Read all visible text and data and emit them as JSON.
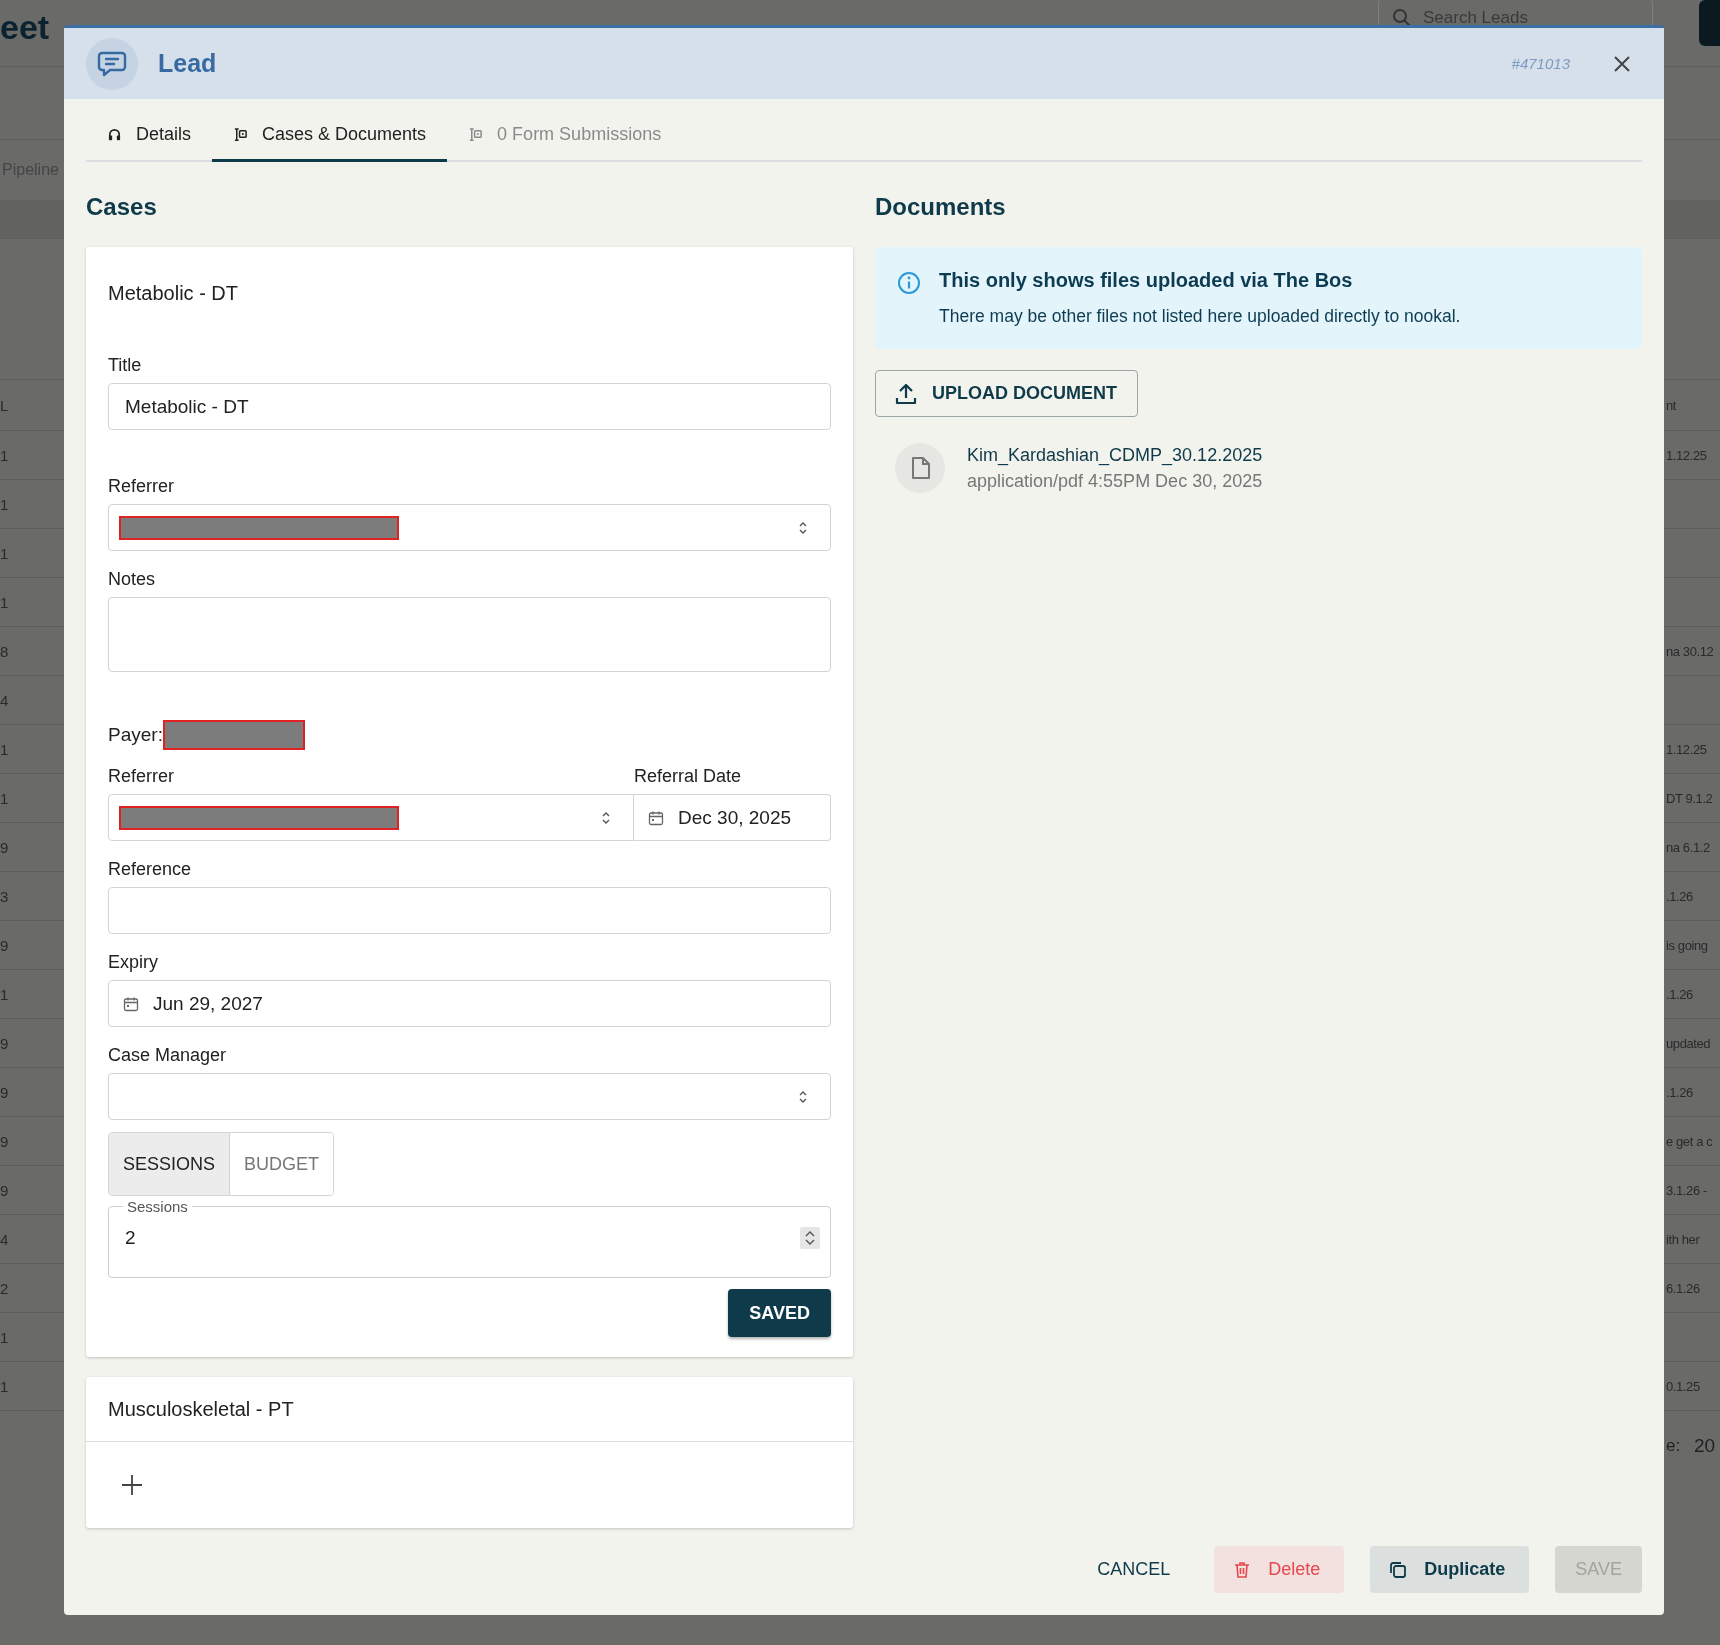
{
  "background": {
    "page_title": "eet",
    "search": {
      "placeholder": "Search Leads"
    },
    "pipeline_label": "Pipeline",
    "table": {
      "columns": [
        "L",
        "nt"
      ],
      "rows": [
        {
          "column_1": "1",
          "column_2": "1.12.25"
        },
        {
          "column_1": "1",
          "column_2": ""
        },
        {
          "column_1": "1",
          "column_2": ""
        },
        {
          "column_1": "1",
          "column_2": ""
        },
        {
          "column_1": "8",
          "column_2": "na 30.12"
        },
        {
          "column_1": "4",
          "column_2": ""
        },
        {
          "column_1": "1",
          "column_2": "1.12.25"
        },
        {
          "column_1": "1",
          "column_2": "DT 9.1.2"
        },
        {
          "column_1": "9",
          "column_2": "na 6.1.2"
        },
        {
          "column_1": "3",
          "column_2": ".1.26"
        },
        {
          "column_1": "9",
          "column_2": "is going"
        },
        {
          "column_1": "1",
          "column_2": ".1.26"
        },
        {
          "column_1": "9",
          "column_2": "updated"
        },
        {
          "column_1": "9",
          "column_2": ".1.26"
        },
        {
          "column_1": "9",
          "column_2": "e get a c"
        },
        {
          "column_1": "9",
          "column_2": "3.1.26 -"
        },
        {
          "column_1": "4",
          "column_2": "ith her"
        },
        {
          "column_1": "2",
          "column_2": "6.1.26"
        },
        {
          "column_1": "1",
          "column_2": ""
        },
        {
          "column_1": "1",
          "column_2": "0.1.25"
        }
      ]
    },
    "footer": {
      "label": "e:",
      "value": "20"
    }
  },
  "lead": {
    "title": "Lead",
    "id": "#471013",
    "tabs": [
      {
        "label": "Details",
        "selected": false,
        "disabled": false
      },
      {
        "label": "Cases & Documents",
        "selected": true,
        "disabled": false
      },
      {
        "label": "0 Form Submissions",
        "selected": false,
        "disabled": true
      }
    ],
    "cases": {
      "heading": "Cases",
      "items": [
        {
          "name": "Metabolic - DT",
          "expanded": true,
          "form": {
            "title": {
              "label": "Title",
              "value": "Metabolic - DT"
            },
            "referrer": {
              "label": "Referrer",
              "redacted": true
            },
            "notes": {
              "label": "Notes"
            },
            "payer": {
              "label": "Payer:",
              "redacted": true
            },
            "payer_referrer": {
              "label": "Referrer",
              "redacted": true
            },
            "referral_date": {
              "label": "Referral Date",
              "value": "Dec 30, 2025"
            },
            "reference": {
              "label": "Reference"
            },
            "expiry": {
              "label": "Expiry",
              "value": "Jun 29, 2027"
            },
            "case_manager": {
              "label": "Case Manager"
            },
            "modes": [
              {
                "label": "SESSIONS",
                "selected": true
              },
              {
                "label": "BUDGET",
                "selected": false
              }
            ],
            "sessions": {
              "label": "Sessions",
              "value": "2"
            },
            "save_button": "SAVED"
          }
        },
        {
          "name": "Musculoskeletal - PT",
          "expanded": false
        }
      ]
    },
    "documents": {
      "heading": "Documents",
      "notice": {
        "title": "This only shows files uploaded via The Bos",
        "text": "There may be other files not listed here uploaded directly to nookal."
      },
      "upload_button": "UPLOAD DOCUMENT",
      "files": [
        {
          "name": "Kim_Kardashian_CDMP_30.12.2025",
          "meta": "application/pdf 4:55PM Dec 30, 2025"
        }
      ]
    },
    "actions": {
      "cancel": "CANCEL",
      "delete": "Delete",
      "duplicate": "Duplicate",
      "save": {
        "label": "SAVE",
        "disabled": true
      }
    }
  }
}
